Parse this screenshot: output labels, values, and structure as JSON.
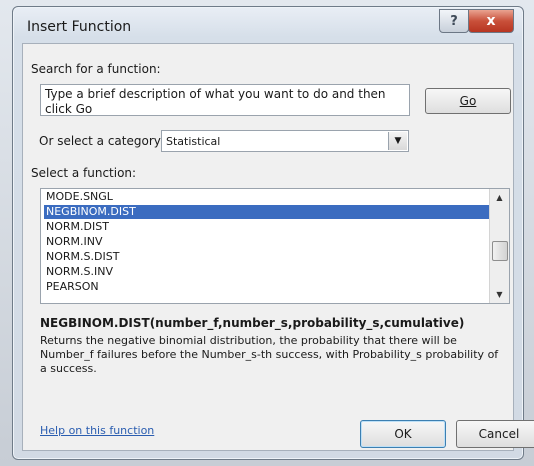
{
  "dialog": {
    "title": "Insert Function",
    "help_button": "?",
    "close_button": "x"
  },
  "search": {
    "label": "Search for a function:",
    "value": "Type a brief description of what you want to do and then click Go",
    "go_label": "Go"
  },
  "category": {
    "label": "Or select a category:",
    "selected": "Statistical"
  },
  "functions": {
    "label": "Select a function:",
    "items": [
      "MODE.SNGL",
      "NEGBINOM.DIST",
      "NORM.DIST",
      "NORM.INV",
      "NORM.S.DIST",
      "NORM.S.INV",
      "PEARSON"
    ],
    "selected_index": 1
  },
  "details": {
    "signature": "NEGBINOM.DIST(number_f,number_s,probability_s,cumulative)",
    "description": "Returns the negative binomial distribution, the probability that there will be Number_f failures before the Number_s-th success, with Probability_s probability of a success."
  },
  "footer": {
    "help_link": "Help on this function",
    "ok_label": "OK",
    "cancel_label": "Cancel"
  }
}
